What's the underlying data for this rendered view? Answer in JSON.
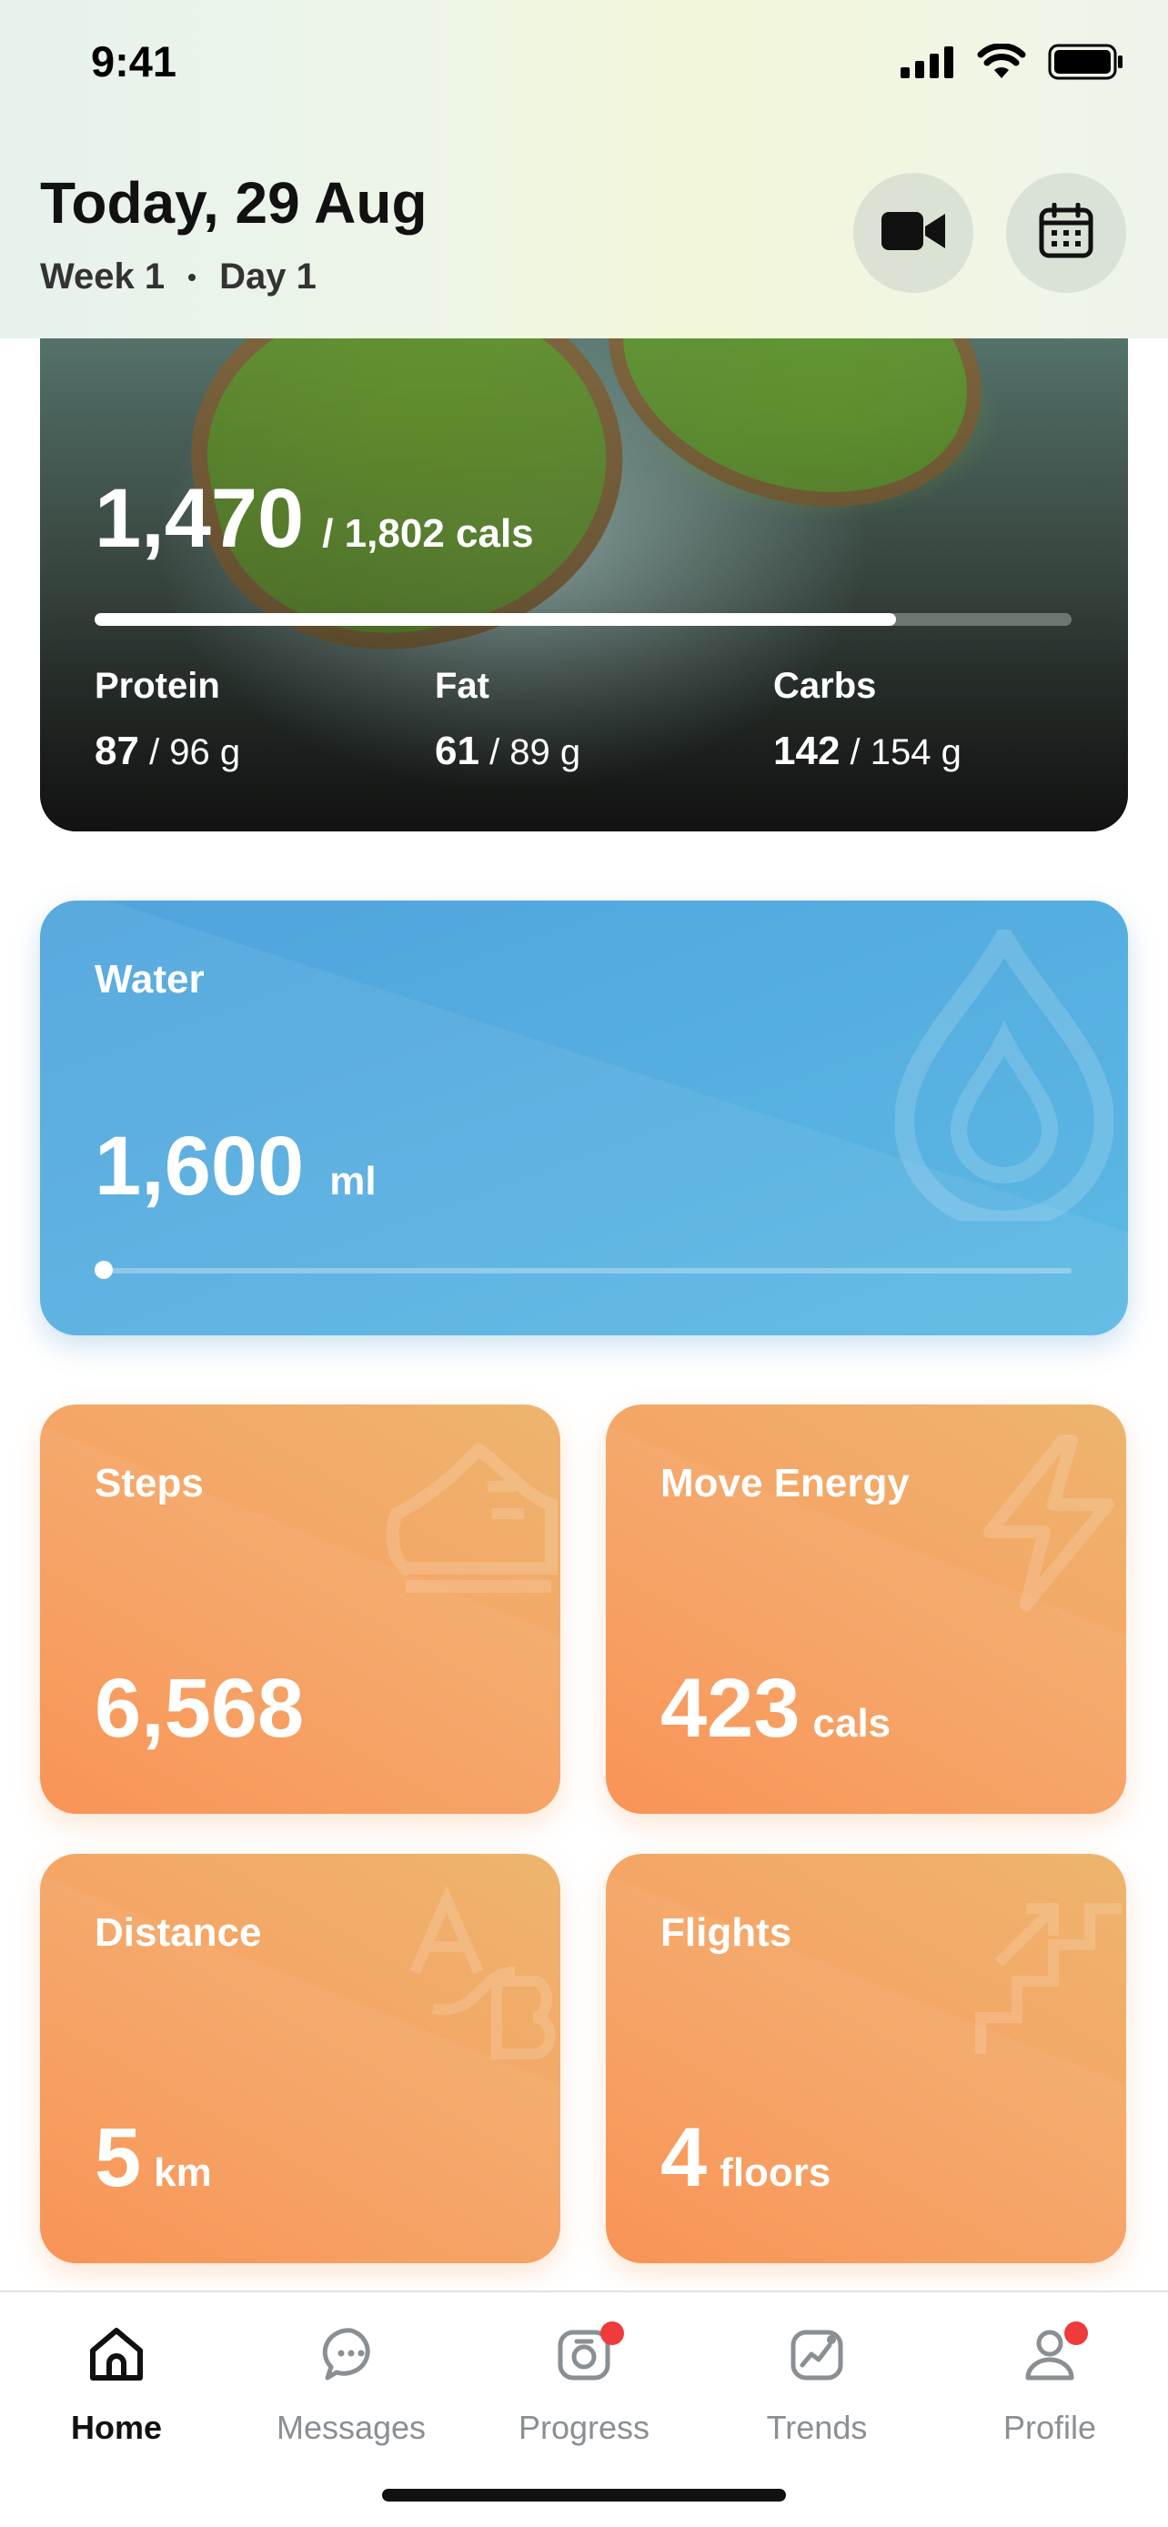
{
  "status_bar": {
    "time": "9:41"
  },
  "header": {
    "title": "Today, 29 Aug",
    "week": "Week 1",
    "day": "Day 1",
    "video_icon": "video-camera-icon",
    "calendar_icon": "calendar-icon"
  },
  "calories": {
    "consumed": "1,470",
    "target": "/ 1,802 cals",
    "progress": 0.82,
    "macros": [
      {
        "label": "Protein",
        "value": "87",
        "target": "/ 96 g"
      },
      {
        "label": "Fat",
        "value": "61",
        "target": "/ 89 g"
      },
      {
        "label": "Carbs",
        "value": "142",
        "target": "/ 154 g"
      }
    ]
  },
  "water": {
    "title": "Water",
    "amount": "1,600",
    "unit": "ml",
    "progress": 0.01,
    "icon": "water-drop-icon"
  },
  "tiles": {
    "steps": {
      "title": "Steps",
      "value": "6,568",
      "unit": "",
      "icon": "sneaker-icon"
    },
    "move": {
      "title": "Move Energy",
      "value": "423",
      "unit": "cals",
      "icon": "lightning-icon"
    },
    "distance": {
      "title": "Distance",
      "value": "5",
      "unit": "km",
      "icon": "a-to-b-icon"
    },
    "flights": {
      "title": "Flights",
      "value": "4",
      "unit": "floors",
      "icon": "stairs-icon"
    }
  },
  "tabs": [
    {
      "label": "Home",
      "icon": "home-icon",
      "active": true
    },
    {
      "label": "Messages",
      "icon": "chat-icon",
      "active": false
    },
    {
      "label": "Progress",
      "icon": "camera-icon",
      "active": false,
      "badge": true
    },
    {
      "label": "Trends",
      "icon": "chart-icon",
      "active": false
    },
    {
      "label": "Profile",
      "icon": "profile-icon",
      "active": false,
      "badge": true
    }
  ],
  "colors": {
    "water_card": "#4fa4dc",
    "tile_orange": "#f5a565",
    "badge_red": "#ef3b3b"
  }
}
